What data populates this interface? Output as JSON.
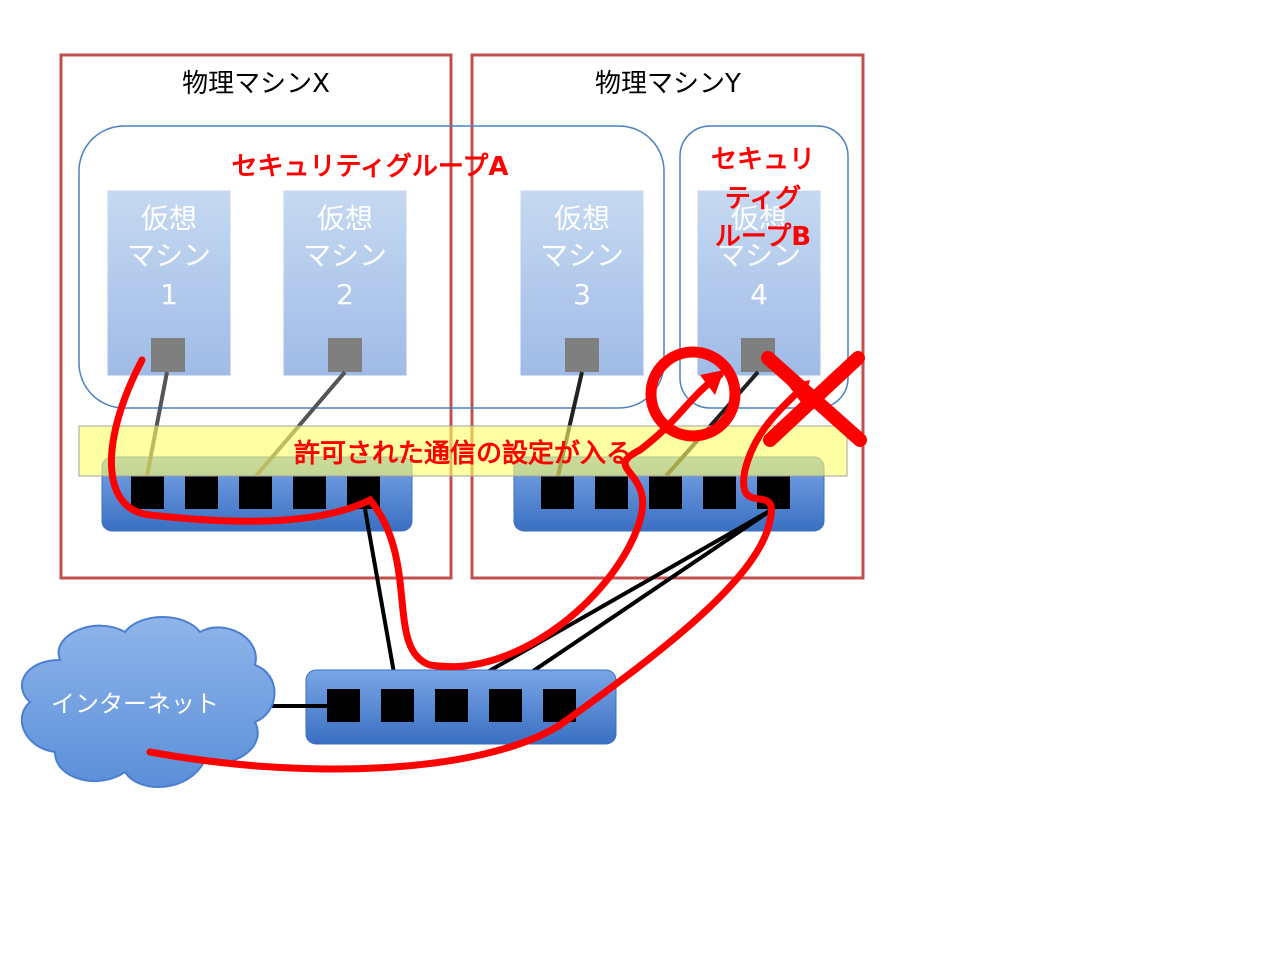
{
  "physical_machines": [
    {
      "title": "物理マシンX"
    },
    {
      "title": "物理マシンY"
    }
  ],
  "security_groups": [
    {
      "label": "セキュリティグループA"
    },
    {
      "label_lines": [
        "セキュリ",
        "ティグ",
        "ループB"
      ]
    }
  ],
  "vms": [
    {
      "lines": [
        "仮想",
        "マシン",
        "1"
      ]
    },
    {
      "lines": [
        "仮想",
        "マシン",
        "2"
      ]
    },
    {
      "lines": [
        "仮想",
        "マシン",
        "3"
      ]
    },
    {
      "lines": [
        "仮想",
        "マシン",
        "4"
      ]
    }
  ],
  "banner": {
    "text": "許可された通信の設定が入る"
  },
  "internet": {
    "label": "インターネット"
  },
  "colors": {
    "machine_border": "#c0504d",
    "group_border": "#4f81bd",
    "vm_fill": "#b9cdf0",
    "switch_fill": "#4a7fd0",
    "route": "#ff0000",
    "banner_fill": "#ffff99"
  }
}
